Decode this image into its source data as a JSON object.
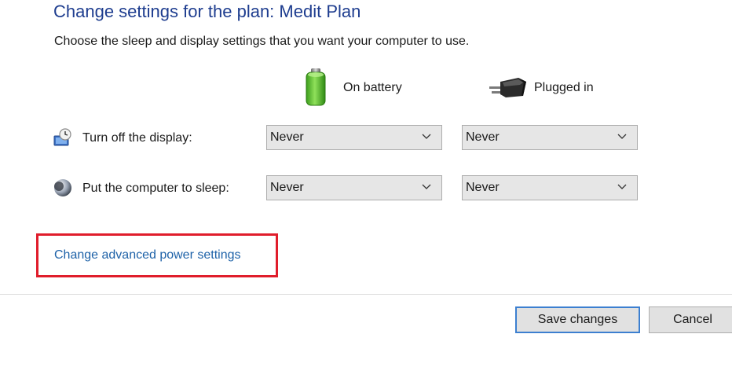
{
  "header": {
    "title": "Change settings for the plan: Medit Plan",
    "subtitle": "Choose the sleep and display settings that you want your computer to use."
  },
  "columns": {
    "battery": {
      "label": "On battery",
      "icon": "battery-icon"
    },
    "plugged": {
      "label": "Plugged in",
      "icon": "plug-icon"
    }
  },
  "rows": [
    {
      "label": "Turn off the display:",
      "icon": "display-timer-icon",
      "battery_value": "Never",
      "plugged_value": "Never"
    },
    {
      "label": "Put the computer to sleep:",
      "icon": "sleep-moon-icon",
      "battery_value": "Never",
      "plugged_value": "Never"
    }
  ],
  "links": {
    "advanced": "Change advanced power settings"
  },
  "buttons": {
    "save": "Save changes",
    "cancel": "Cancel"
  },
  "colors": {
    "title": "#1e3d8f",
    "link": "#1e62a8",
    "highlight": "#e01d2b",
    "primary_border": "#3c7fd0"
  }
}
